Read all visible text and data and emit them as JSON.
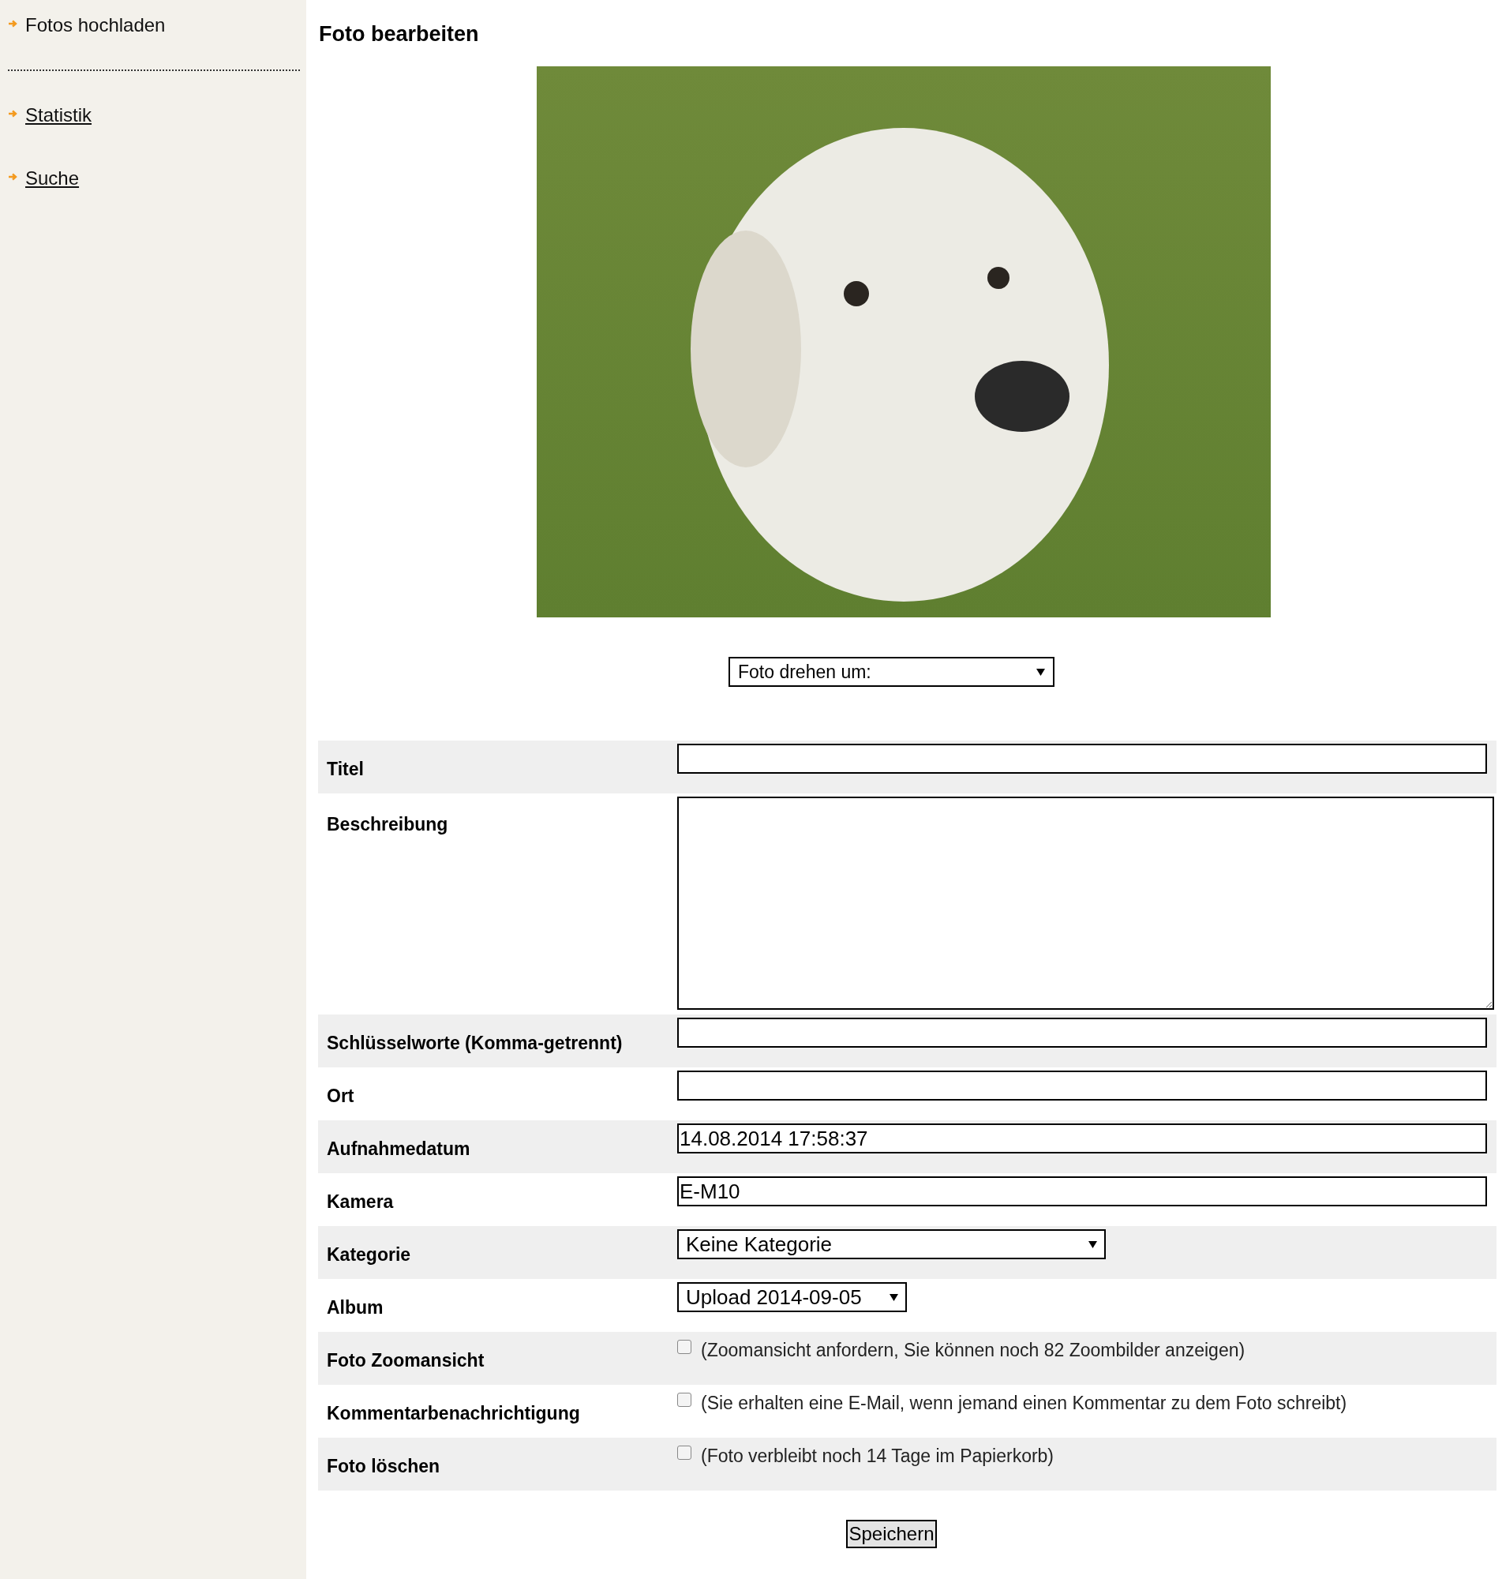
{
  "sidebar": {
    "items": [
      {
        "label": "Fotos hochladen",
        "kind": "plain"
      },
      {
        "kind": "divider"
      },
      {
        "label": "Statistik",
        "kind": "link"
      },
      {
        "label": "Suche",
        "kind": "link"
      }
    ]
  },
  "page_title": "Foto bearbeiten",
  "rotate_select": {
    "value": "Foto drehen um:"
  },
  "form": {
    "rows": [
      {
        "label": "Titel",
        "kind": "input",
        "value": ""
      },
      {
        "label": "Beschreibung",
        "kind": "textarea",
        "value": ""
      },
      {
        "label": "Schlüsselworte (Komma-getrennt)",
        "kind": "input",
        "value": ""
      },
      {
        "label": "Ort",
        "kind": "input",
        "value": ""
      },
      {
        "label": "Aufnahmedatum",
        "kind": "input",
        "value": "14.08.2014 17:58:37"
      },
      {
        "label": "Kamera",
        "kind": "input",
        "value": "E-M10"
      },
      {
        "label": "Kategorie",
        "kind": "wide_select",
        "value": "Keine Kategorie"
      },
      {
        "label": "Album",
        "kind": "select",
        "value": "Upload 2014-09-05"
      },
      {
        "label": "Foto Zoomansicht",
        "kind": "checkbox",
        "checked": false,
        "note": "(Zoomansicht anfordern, Sie können noch 82 Zoombilder anzeigen)"
      },
      {
        "label": "Kommentarbenachrichtigung",
        "kind": "checkbox",
        "checked": false,
        "note": "(Sie erhalten eine E-Mail, wenn jemand einen Kommentar zu dem Foto schreibt)"
      },
      {
        "label": "Foto löschen",
        "kind": "checkbox",
        "checked": false,
        "note": "(Foto verbleibt noch 14 Tage im Papierkorb)"
      }
    ]
  },
  "save_button": "Speichern"
}
